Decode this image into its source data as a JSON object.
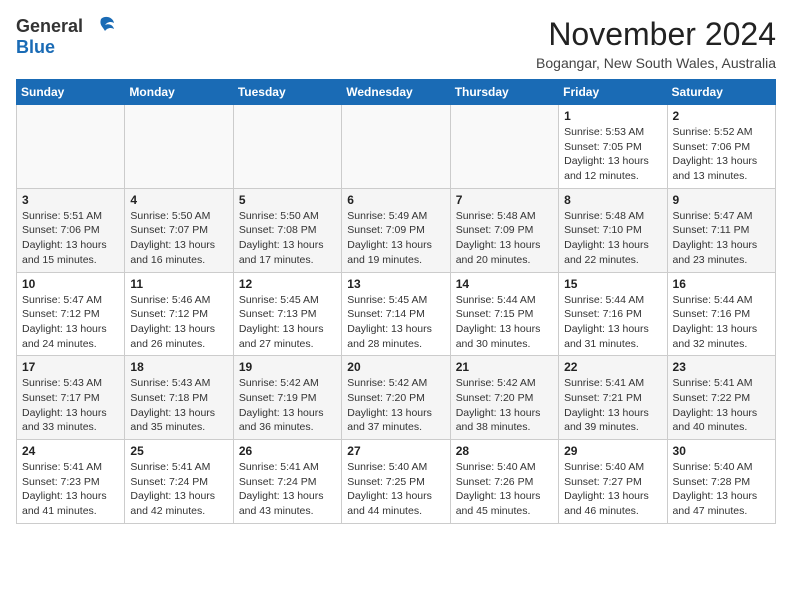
{
  "header": {
    "logo_general": "General",
    "logo_blue": "Blue",
    "month_title": "November 2024",
    "location": "Bogangar, New South Wales, Australia"
  },
  "weekdays": [
    "Sunday",
    "Monday",
    "Tuesday",
    "Wednesday",
    "Thursday",
    "Friday",
    "Saturday"
  ],
  "weeks": [
    [
      {
        "day": "",
        "info": ""
      },
      {
        "day": "",
        "info": ""
      },
      {
        "day": "",
        "info": ""
      },
      {
        "day": "",
        "info": ""
      },
      {
        "day": "",
        "info": ""
      },
      {
        "day": "1",
        "info": "Sunrise: 5:53 AM\nSunset: 7:05 PM\nDaylight: 13 hours\nand 12 minutes."
      },
      {
        "day": "2",
        "info": "Sunrise: 5:52 AM\nSunset: 7:06 PM\nDaylight: 13 hours\nand 13 minutes."
      }
    ],
    [
      {
        "day": "3",
        "info": "Sunrise: 5:51 AM\nSunset: 7:06 PM\nDaylight: 13 hours\nand 15 minutes."
      },
      {
        "day": "4",
        "info": "Sunrise: 5:50 AM\nSunset: 7:07 PM\nDaylight: 13 hours\nand 16 minutes."
      },
      {
        "day": "5",
        "info": "Sunrise: 5:50 AM\nSunset: 7:08 PM\nDaylight: 13 hours\nand 17 minutes."
      },
      {
        "day": "6",
        "info": "Sunrise: 5:49 AM\nSunset: 7:09 PM\nDaylight: 13 hours\nand 19 minutes."
      },
      {
        "day": "7",
        "info": "Sunrise: 5:48 AM\nSunset: 7:09 PM\nDaylight: 13 hours\nand 20 minutes."
      },
      {
        "day": "8",
        "info": "Sunrise: 5:48 AM\nSunset: 7:10 PM\nDaylight: 13 hours\nand 22 minutes."
      },
      {
        "day": "9",
        "info": "Sunrise: 5:47 AM\nSunset: 7:11 PM\nDaylight: 13 hours\nand 23 minutes."
      }
    ],
    [
      {
        "day": "10",
        "info": "Sunrise: 5:47 AM\nSunset: 7:12 PM\nDaylight: 13 hours\nand 24 minutes."
      },
      {
        "day": "11",
        "info": "Sunrise: 5:46 AM\nSunset: 7:12 PM\nDaylight: 13 hours\nand 26 minutes."
      },
      {
        "day": "12",
        "info": "Sunrise: 5:45 AM\nSunset: 7:13 PM\nDaylight: 13 hours\nand 27 minutes."
      },
      {
        "day": "13",
        "info": "Sunrise: 5:45 AM\nSunset: 7:14 PM\nDaylight: 13 hours\nand 28 minutes."
      },
      {
        "day": "14",
        "info": "Sunrise: 5:44 AM\nSunset: 7:15 PM\nDaylight: 13 hours\nand 30 minutes."
      },
      {
        "day": "15",
        "info": "Sunrise: 5:44 AM\nSunset: 7:16 PM\nDaylight: 13 hours\nand 31 minutes."
      },
      {
        "day": "16",
        "info": "Sunrise: 5:44 AM\nSunset: 7:16 PM\nDaylight: 13 hours\nand 32 minutes."
      }
    ],
    [
      {
        "day": "17",
        "info": "Sunrise: 5:43 AM\nSunset: 7:17 PM\nDaylight: 13 hours\nand 33 minutes."
      },
      {
        "day": "18",
        "info": "Sunrise: 5:43 AM\nSunset: 7:18 PM\nDaylight: 13 hours\nand 35 minutes."
      },
      {
        "day": "19",
        "info": "Sunrise: 5:42 AM\nSunset: 7:19 PM\nDaylight: 13 hours\nand 36 minutes."
      },
      {
        "day": "20",
        "info": "Sunrise: 5:42 AM\nSunset: 7:20 PM\nDaylight: 13 hours\nand 37 minutes."
      },
      {
        "day": "21",
        "info": "Sunrise: 5:42 AM\nSunset: 7:20 PM\nDaylight: 13 hours\nand 38 minutes."
      },
      {
        "day": "22",
        "info": "Sunrise: 5:41 AM\nSunset: 7:21 PM\nDaylight: 13 hours\nand 39 minutes."
      },
      {
        "day": "23",
        "info": "Sunrise: 5:41 AM\nSunset: 7:22 PM\nDaylight: 13 hours\nand 40 minutes."
      }
    ],
    [
      {
        "day": "24",
        "info": "Sunrise: 5:41 AM\nSunset: 7:23 PM\nDaylight: 13 hours\nand 41 minutes."
      },
      {
        "day": "25",
        "info": "Sunrise: 5:41 AM\nSunset: 7:24 PM\nDaylight: 13 hours\nand 42 minutes."
      },
      {
        "day": "26",
        "info": "Sunrise: 5:41 AM\nSunset: 7:24 PM\nDaylight: 13 hours\nand 43 minutes."
      },
      {
        "day": "27",
        "info": "Sunrise: 5:40 AM\nSunset: 7:25 PM\nDaylight: 13 hours\nand 44 minutes."
      },
      {
        "day": "28",
        "info": "Sunrise: 5:40 AM\nSunset: 7:26 PM\nDaylight: 13 hours\nand 45 minutes."
      },
      {
        "day": "29",
        "info": "Sunrise: 5:40 AM\nSunset: 7:27 PM\nDaylight: 13 hours\nand 46 minutes."
      },
      {
        "day": "30",
        "info": "Sunrise: 5:40 AM\nSunset: 7:28 PM\nDaylight: 13 hours\nand 47 minutes."
      }
    ]
  ]
}
